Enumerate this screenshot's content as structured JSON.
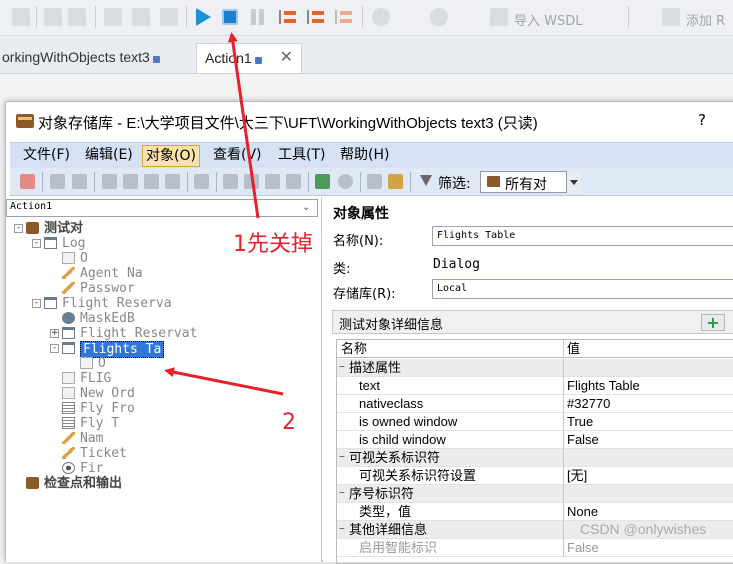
{
  "ide": {
    "toolbar_text_1": "导入 WSDL",
    "toolbar_text_2": "添加 R",
    "tabs": [
      {
        "label": "orkingWithObjects text3"
      },
      {
        "label": "Action1"
      }
    ]
  },
  "dialog": {
    "title": "对象存储库 - E:\\大学项目文件\\大三下\\UFT\\WorkingWithObjects text3 (只读)",
    "help": "?",
    "menus": [
      "文件(F)",
      "编辑(E)",
      "对象(O)",
      "查看(V)",
      "工具(T)",
      "帮助(H)"
    ],
    "active_menu": "对象(O)",
    "filter_label": "筛选:",
    "filter_value": "所有对",
    "action_select": "Action1"
  },
  "tree": [
    {
      "label": "测试对",
      "level": 0,
      "bold": true,
      "icon": "folder-icon",
      "toggle": "-"
    },
    {
      "label": "Log",
      "level": 1,
      "icon": "window-icon",
      "toggle": "-"
    },
    {
      "label": "O",
      "level": 2,
      "icon": "checkbox-icon"
    },
    {
      "label": "Agent Na",
      "level": 2,
      "icon": "edit-icon"
    },
    {
      "label": "Passwor",
      "level": 2,
      "icon": "edit-icon"
    },
    {
      "label": "Flight Reserva",
      "level": 1,
      "icon": "window-icon",
      "toggle": "-"
    },
    {
      "label": "MaskEdB",
      "level": 2,
      "icon": "gear-icon"
    },
    {
      "label": "Flight Reservat",
      "level": 2,
      "icon": "window-icon",
      "toggle": "+"
    },
    {
      "label": "Flights Ta",
      "level": 2,
      "icon": "window-icon",
      "toggle": "-",
      "selected": true
    },
    {
      "label": "O",
      "level": 3,
      "icon": "checkbox-icon"
    },
    {
      "label": "FLIG",
      "level": 2,
      "icon": "checkbox-icon"
    },
    {
      "label": "New Ord",
      "level": 2,
      "icon": "button-icon"
    },
    {
      "label": "Fly Fro",
      "level": 2,
      "icon": "list-icon"
    },
    {
      "label": "Fly T",
      "level": 2,
      "icon": "list-icon"
    },
    {
      "label": "Nam",
      "level": 2,
      "icon": "edit-icon"
    },
    {
      "label": "Ticket",
      "level": 2,
      "icon": "edit-icon"
    },
    {
      "label": "Fir",
      "level": 2,
      "icon": "radio-icon"
    },
    {
      "label": "检查点和输出",
      "level": 0,
      "bold": true,
      "icon": "folder-icon"
    }
  ],
  "props": {
    "header": "对象属性",
    "name_label": "名称(N):",
    "name_value": "Flights Table",
    "class_label": "类:",
    "class_value": "Dialog",
    "repo_label": "存储库(R):",
    "repo_value": "Local",
    "details_title": "测试对象详细信息",
    "add_button": "+",
    "grid_header": [
      "名称",
      "值"
    ],
    "grid_rows": [
      {
        "type": "cat",
        "name": "描述属性"
      },
      {
        "type": "row",
        "name": "text",
        "value": "Flights Table"
      },
      {
        "type": "row",
        "name": "nativeclass",
        "value": "#32770"
      },
      {
        "type": "row",
        "name": "is owned window",
        "value": "True"
      },
      {
        "type": "row",
        "name": "is child window",
        "value": "False"
      },
      {
        "type": "cat",
        "name": "可视关系标识符"
      },
      {
        "type": "row",
        "name": "可视关系标识符设置",
        "value": "[无]"
      },
      {
        "type": "cat",
        "name": "序号标识符"
      },
      {
        "type": "row",
        "name": "类型，值",
        "value": "None"
      },
      {
        "type": "cat",
        "name": "其他详细信息"
      },
      {
        "type": "row",
        "name": "启用智能标识",
        "value": "False"
      }
    ]
  },
  "annotations": {
    "note1": "1先关掉",
    "note2": "2",
    "color": "#e8202a"
  },
  "watermark": "CSDN @onlywishes"
}
